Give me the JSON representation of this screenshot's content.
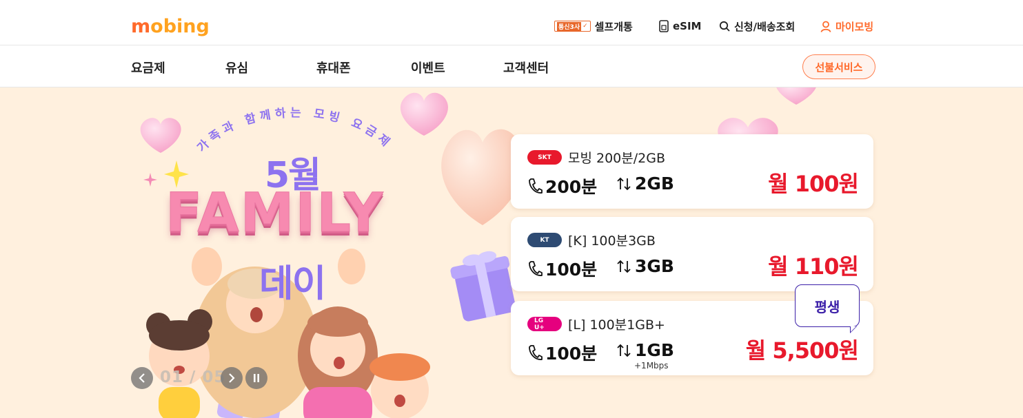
{
  "header": {
    "logo": "mobing",
    "links": [
      {
        "label": "셀프개통",
        "badge": "통신3사",
        "icon": "check-badge-icon"
      },
      {
        "label": "eSIM",
        "icon": "sim-icon"
      },
      {
        "label": "신청/배송조회",
        "icon": "search-icon"
      },
      {
        "label": "마이모빙",
        "icon": "user-icon"
      }
    ]
  },
  "nav": {
    "items": [
      "요금제",
      "유심",
      "휴대폰",
      "이벤트",
      "고객센터"
    ],
    "prepaid_button": "선불서비스"
  },
  "hero": {
    "subtitle": "가족과 함께하는 모빙 요금제",
    "month": "5월",
    "headline": "FAMILY",
    "day": "데이",
    "pager": "01 / 05",
    "badge": "평생"
  },
  "plans": [
    {
      "carrier": "SKT",
      "carrier_color": "#e8192c",
      "name": "모빙 200분/2GB",
      "voice": "200분",
      "data": "2GB",
      "extra": "",
      "price": "월 100원"
    },
    {
      "carrier": "KT",
      "carrier_color": "#2e4b73",
      "name": "[K] 100분3GB",
      "voice": "100분",
      "data": "3GB",
      "extra": "",
      "price": "월 110원"
    },
    {
      "carrier": "LG U+",
      "carrier_color": "#e5007e",
      "name": "[L] 100분1GB+",
      "voice": "100분",
      "data": "1GB",
      "extra": "+1Mbps",
      "price": "월 5,500원"
    }
  ],
  "colors": {
    "brand_orange": "#ff6a2b",
    "price_red": "#e8192c",
    "hero_bg": "#fff0de",
    "accent_purple": "#8d72ef"
  }
}
